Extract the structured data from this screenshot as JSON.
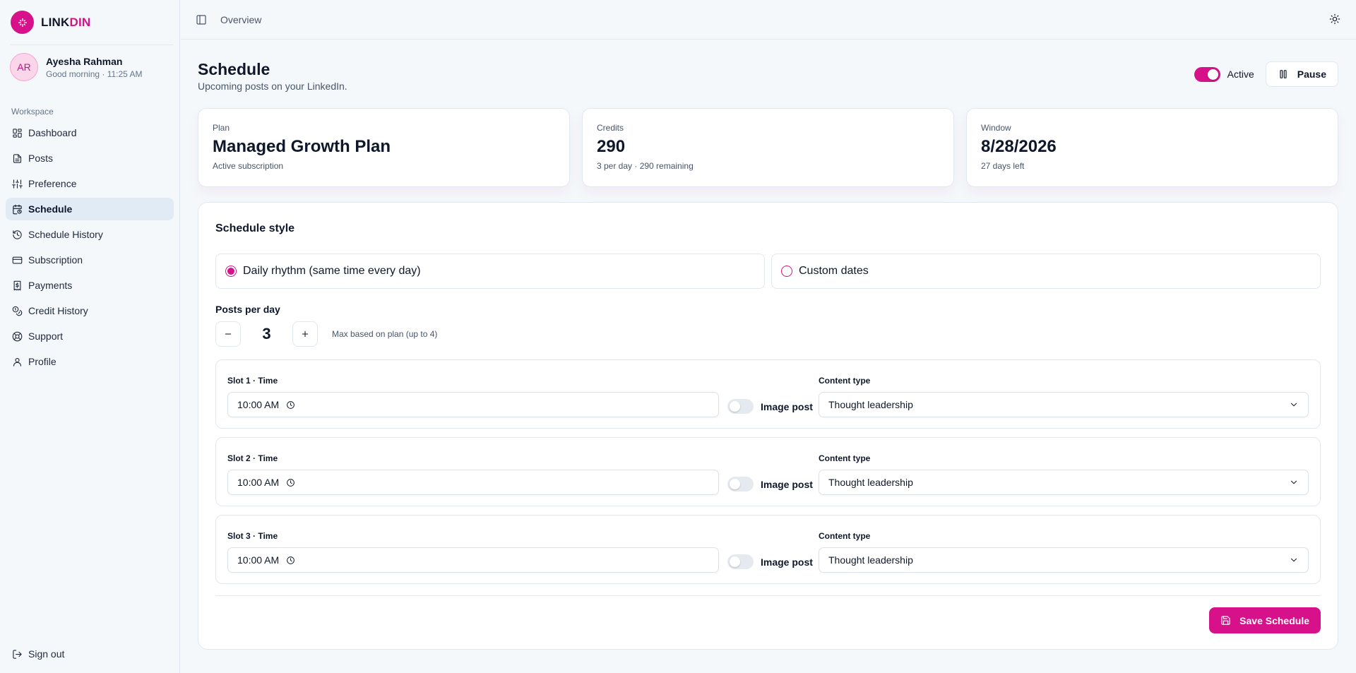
{
  "brand": {
    "name_part1": "LINK",
    "name_part2": "DIN",
    "accent_color": "#d6118a"
  },
  "user": {
    "initials": "AR",
    "name": "Ayesha Rahman",
    "greeting": "Good morning · 11:25 AM"
  },
  "sidebar": {
    "section_label": "Workspace",
    "items": [
      {
        "label": "Dashboard",
        "icon": "dashboard-icon"
      },
      {
        "label": "Posts",
        "icon": "document-icon"
      },
      {
        "label": "Preference",
        "icon": "sliders-icon"
      },
      {
        "label": "Schedule",
        "icon": "calendar-clock-icon",
        "active": true
      },
      {
        "label": "Schedule History",
        "icon": "history-icon"
      },
      {
        "label": "Subscription",
        "icon": "credit-card-icon"
      },
      {
        "label": "Payments",
        "icon": "receipt-icon"
      },
      {
        "label": "Credit History",
        "icon": "coins-icon"
      },
      {
        "label": "Support",
        "icon": "lifebuoy-icon"
      },
      {
        "label": "Profile",
        "icon": "user-icon"
      }
    ],
    "signout_label": "Sign out"
  },
  "topbar": {
    "breadcrumb": "Overview"
  },
  "page": {
    "title": "Schedule",
    "subtitle": "Upcoming posts on your LinkedIn."
  },
  "status": {
    "label": "Active",
    "active": true,
    "pause_label": "Pause"
  },
  "stats": [
    {
      "label": "Plan",
      "value": "Managed Growth Plan",
      "sub": "Active subscription"
    },
    {
      "label": "Credits",
      "value": "290",
      "sub": "3 per day · 290 remaining"
    },
    {
      "label": "Window",
      "value": "8/28/2026",
      "sub": "27 days left"
    }
  ],
  "schedule": {
    "style_title": "Schedule style",
    "options": [
      {
        "label": "Daily rhythm (same time every day)",
        "selected": true
      },
      {
        "label": "Custom dates",
        "selected": false
      }
    ],
    "posts_per_day_label": "Posts per day",
    "posts_per_day": "3",
    "max_hint": "Max based on plan (up to 4)",
    "content_type_label": "Content type",
    "image_post_label": "Image post",
    "slots": [
      {
        "time_label": "Slot 1 · Time",
        "time": "10:00 AM",
        "image_post": false,
        "content_type": "Thought leadership"
      },
      {
        "time_label": "Slot 2 · Time",
        "time": "10:00 AM",
        "image_post": false,
        "content_type": "Thought leadership"
      },
      {
        "time_label": "Slot 3 · Time",
        "time": "10:00 AM",
        "image_post": false,
        "content_type": "Thought leadership"
      }
    ],
    "save_label": "Save Schedule"
  }
}
